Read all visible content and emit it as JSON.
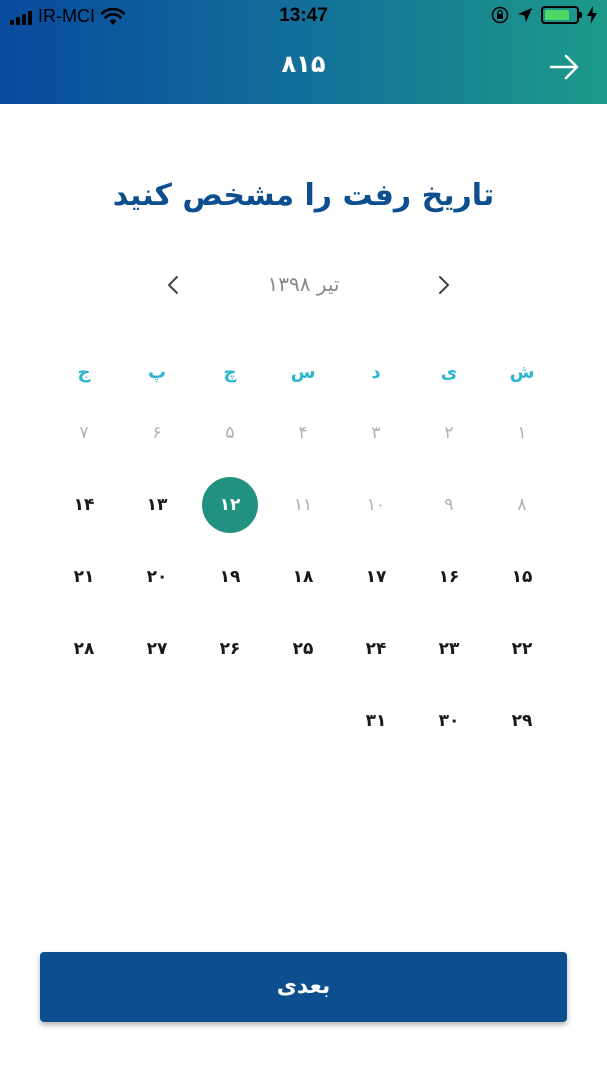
{
  "status_bar": {
    "carrier": "IR-MCI",
    "time": "13:47",
    "battery_level": 0.8,
    "battery_color": "#4cd964"
  },
  "header": {
    "title": "۸۱۵",
    "back_icon": "arrow-right-icon",
    "gradient": [
      "#0a4a9e",
      "#1d9a8a"
    ]
  },
  "page": {
    "title": "تاریخ رفت را مشخص کنید"
  },
  "calendar": {
    "month_label": "تیر ۱۳۹۸",
    "prev_icon": "chevron-left-icon",
    "next_icon": "chevron-right-icon",
    "weekdays": [
      "ش",
      "ی",
      "د",
      "س",
      "چ",
      "پ",
      "ج"
    ],
    "days": [
      {
        "label": "۱",
        "state": "past"
      },
      {
        "label": "۲",
        "state": "past"
      },
      {
        "label": "۳",
        "state": "past"
      },
      {
        "label": "۴",
        "state": "past"
      },
      {
        "label": "۵",
        "state": "past"
      },
      {
        "label": "۶",
        "state": "past"
      },
      {
        "label": "۷",
        "state": "past"
      },
      {
        "label": "۸",
        "state": "past"
      },
      {
        "label": "۹",
        "state": "past"
      },
      {
        "label": "۱۰",
        "state": "past"
      },
      {
        "label": "۱۱",
        "state": "past"
      },
      {
        "label": "۱۲",
        "state": "selected"
      },
      {
        "label": "۱۳",
        "state": "active"
      },
      {
        "label": "۱۴",
        "state": "active"
      },
      {
        "label": "۱۵",
        "state": "active"
      },
      {
        "label": "۱۶",
        "state": "active"
      },
      {
        "label": "۱۷",
        "state": "active"
      },
      {
        "label": "۱۸",
        "state": "active"
      },
      {
        "label": "۱۹",
        "state": "active"
      },
      {
        "label": "۲۰",
        "state": "active"
      },
      {
        "label": "۲۱",
        "state": "active"
      },
      {
        "label": "۲۲",
        "state": "active"
      },
      {
        "label": "۲۳",
        "state": "active"
      },
      {
        "label": "۲۴",
        "state": "active"
      },
      {
        "label": "۲۵",
        "state": "active"
      },
      {
        "label": "۲۶",
        "state": "active"
      },
      {
        "label": "۲۷",
        "state": "active"
      },
      {
        "label": "۲۸",
        "state": "active"
      },
      {
        "label": "۲۹",
        "state": "active"
      },
      {
        "label": "۳۰",
        "state": "active"
      },
      {
        "label": "۳۱",
        "state": "active"
      }
    ],
    "weekday_color": "#2bb6cf",
    "selected_color": "#22917f"
  },
  "footer": {
    "next_label": "بعدی",
    "button_color": "#0d4e8e"
  }
}
